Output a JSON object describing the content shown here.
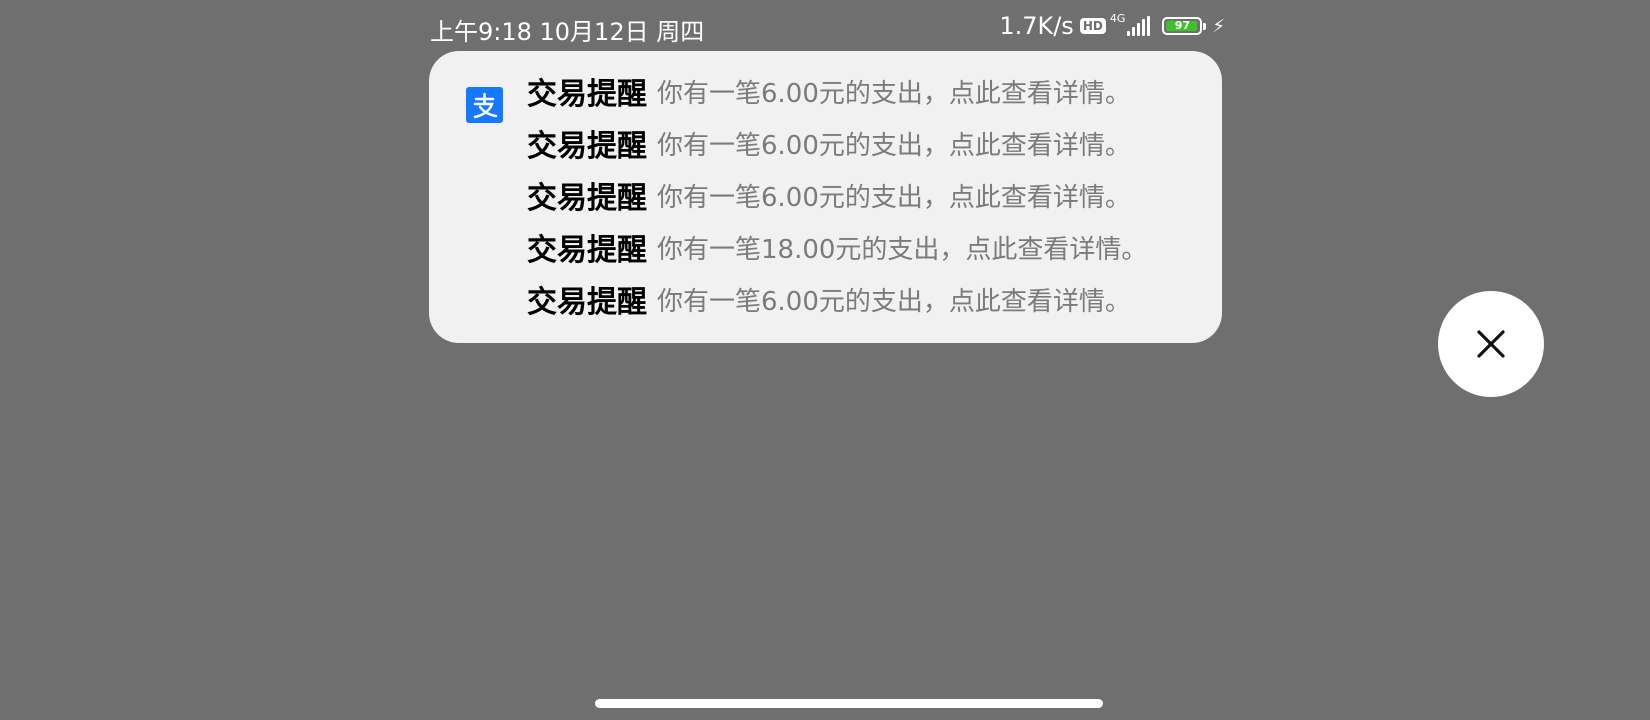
{
  "status_bar": {
    "time_date": "上午9:18 10月12日 周四",
    "network_speed": "1.7K/s",
    "hd_label": "HD",
    "network_type": "4G",
    "battery_level": "97",
    "battery_fraction": 0.97
  },
  "notification": {
    "app_icon": "alipay-icon",
    "accent_color": "#1677ff",
    "items": [
      {
        "title": "交易提醒",
        "text": "你有一笔6.00元的支出，点此查看详情。"
      },
      {
        "title": "交易提醒",
        "text": "你有一笔6.00元的支出，点此查看详情。"
      },
      {
        "title": "交易提醒",
        "text": "你有一笔6.00元的支出，点此查看详情。"
      },
      {
        "title": "交易提醒",
        "text": "你有一笔18.00元的支出，点此查看详情。"
      },
      {
        "title": "交易提醒",
        "text": "你有一笔6.00元的支出，点此查看详情。"
      }
    ]
  },
  "close_button": {
    "icon": "close-icon"
  }
}
